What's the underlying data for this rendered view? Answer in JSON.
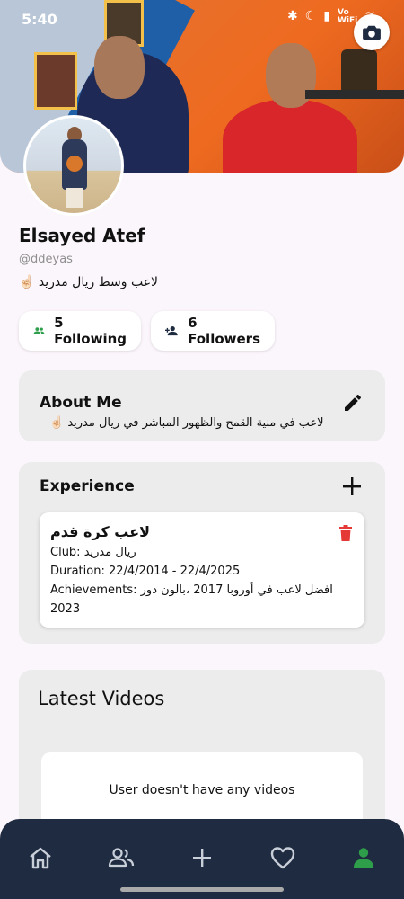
{
  "status_bar": {
    "time": "5:40",
    "icons": [
      "bluetooth-icon",
      "moon-icon",
      "signal-icon",
      "vowifi-icon",
      "wifi-icon",
      "battery-icon"
    ]
  },
  "profile": {
    "name": "Elsayed Atef",
    "handle": "@ddeyas",
    "bio": "لاعب وسط ريال مدريد ☝🏻"
  },
  "stats": {
    "following_label": "5 Following",
    "followers_label": "6 Followers"
  },
  "about": {
    "title": "About Me",
    "text": "لاعب في منية القمح والظهور المباشر في ريال مدريد ☝🏻"
  },
  "experience": {
    "title": "Experience",
    "items": [
      {
        "title": "لاعب كرة قدم",
        "club": "Club: ريال مدريد",
        "duration": "Duration: 22/4/2014 - 22/4/2025",
        "achievements": "Achievements: افضل لاعب في أوروبا 2017 ،بالون دور 2023"
      }
    ]
  },
  "videos": {
    "title": "Latest Videos",
    "empty_message": "User doesn't have any videos"
  },
  "nav": [
    "home-icon",
    "people-icon",
    "add-icon",
    "heart-icon",
    "profile-icon"
  ],
  "colors": {
    "accent_green": "#2e9e4a",
    "nav_bg": "#1f2b40",
    "delete_red": "#e53935"
  }
}
